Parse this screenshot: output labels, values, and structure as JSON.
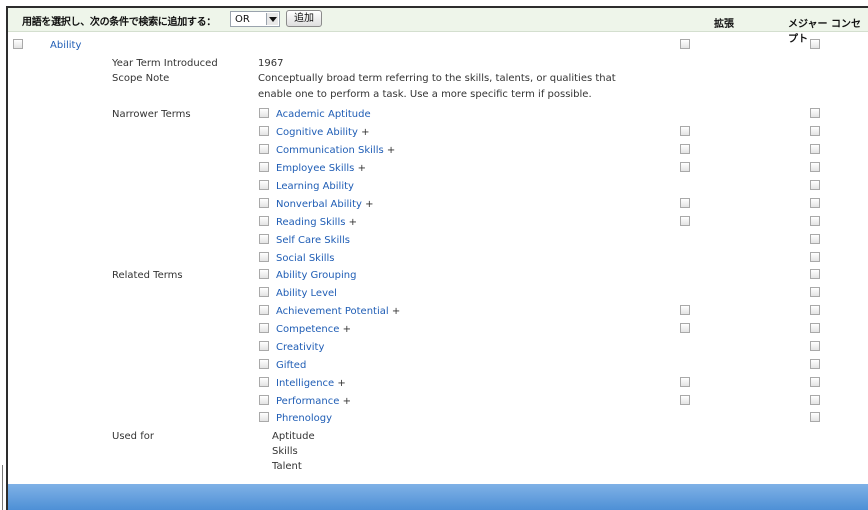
{
  "header": {
    "label": "用語を選択し、次の条件で検索に追加する：",
    "operator": "OR",
    "add_button": "追加",
    "col_explode": "拡張",
    "col_major": "メジャー コンセプト"
  },
  "term": {
    "name": "Ability",
    "year_label": "Year Term Introduced",
    "year_value": "1967",
    "scope_label": "Scope Note",
    "scope_lines": [
      "Conceptually broad term referring to the skills, talents, or qualities that",
      "enable one to perform a task. Use a more specific term if possible."
    ]
  },
  "narrower": {
    "label": "Narrower Terms",
    "items": [
      {
        "name": "Academic Aptitude",
        "plus": ""
      },
      {
        "name": "Cognitive Ability",
        "plus": "+"
      },
      {
        "name": "Communication Skills",
        "plus": "+"
      },
      {
        "name": "Employee Skills",
        "plus": "+"
      },
      {
        "name": "Learning Ability",
        "plus": ""
      },
      {
        "name": "Nonverbal Ability",
        "plus": "+"
      },
      {
        "name": "Reading Skills",
        "plus": "+"
      },
      {
        "name": "Self Care Skills",
        "plus": ""
      },
      {
        "name": "Social Skills",
        "plus": ""
      }
    ]
  },
  "related": {
    "label": "Related Terms",
    "items": [
      {
        "name": "Ability Grouping",
        "plus": ""
      },
      {
        "name": "Ability Level",
        "plus": ""
      },
      {
        "name": "Achievement Potential",
        "plus": "+"
      },
      {
        "name": "Competence",
        "plus": "+"
      },
      {
        "name": "Creativity",
        "plus": ""
      },
      {
        "name": "Gifted",
        "plus": ""
      },
      {
        "name": "Intelligence",
        "plus": "+"
      },
      {
        "name": "Performance",
        "plus": "+"
      },
      {
        "name": "Phrenology",
        "plus": ""
      }
    ]
  },
  "used_for": {
    "label": "Used for",
    "items": [
      "Aptitude",
      "Skills",
      "Talent"
    ]
  }
}
